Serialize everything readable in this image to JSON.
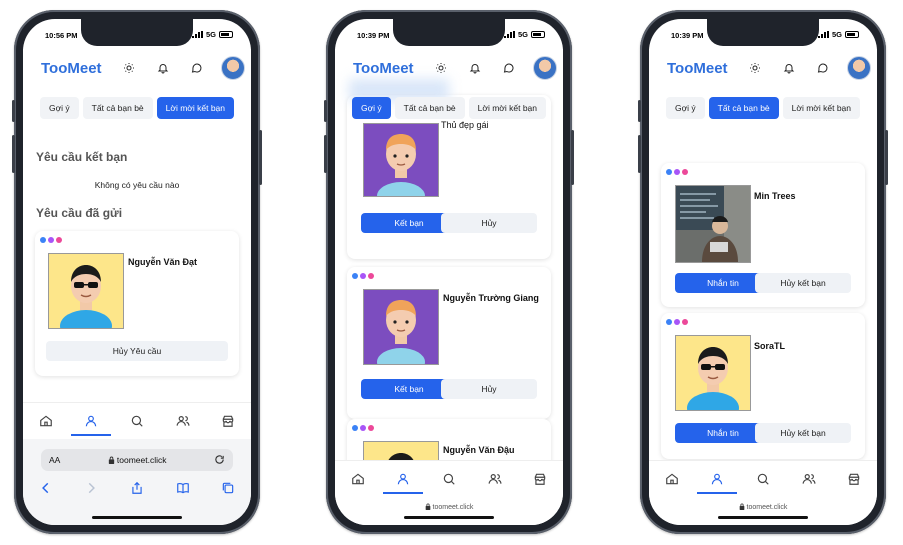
{
  "colors": {
    "accent": "#2563eb",
    "logo": "#2f6fdb",
    "dot1": "#3b82f6",
    "dot2": "#a855f7",
    "dot3": "#ec4899"
  },
  "phones": [
    {
      "time": "10:56 PM",
      "net": "5G",
      "logo": "TooMeet",
      "tabs": [
        "Gợi ý",
        "Tất cả bạn bè",
        "Lời mời kết bạn"
      ],
      "active_tab": 2,
      "requests_title": "Yêu cầu kết bạn",
      "no_requests": "Không có yêu cầu nào",
      "sent_title": "Yêu cầu đã gửi",
      "sent_card": {
        "name": "Nguyễn Văn Đạt",
        "button": "Hủy Yêu cầu",
        "avatar": "avatar-sunglasses"
      },
      "safari": {
        "aa": "AA",
        "url": "toomeet.click"
      }
    },
    {
      "time": "10:39 PM",
      "net": "5G",
      "logo": "TooMeet",
      "tabs": [
        "Gợi ý",
        "Tất cả bạn bè",
        "Lời mời kết bạn"
      ],
      "active_tab": 0,
      "partial_name": "Thủ đẹp gái",
      "cards": [
        {
          "name": "Thủ đẹp gái",
          "primary": "Kết bạn",
          "secondary": "Hủy",
          "avatar": "avatar-orange-hair"
        },
        {
          "name": "Nguyễn Trường Giang",
          "primary": "Kết bạn",
          "secondary": "Hủy",
          "avatar": "avatar-orange-hair"
        },
        {
          "name": "Nguyễn Văn Đậu",
          "avatar": "avatar-sunglasses"
        }
      ],
      "url": "toomeet.click"
    },
    {
      "time": "10:39 PM",
      "net": "5G",
      "logo": "TooMeet",
      "tabs": [
        "Gợi ý",
        "Tất cả bạn bè",
        "Lời mời kết bạn"
      ],
      "active_tab": 1,
      "cards": [
        {
          "name": "Min Trees",
          "primary": "Nhắn tin",
          "secondary": "Hủy kết bạn",
          "avatar": "photo-person-laptop"
        },
        {
          "name": "SoraTL",
          "primary": "Nhắn tin",
          "secondary": "Hủy kết bạn",
          "avatar": "avatar-sunglasses"
        }
      ],
      "url": "toomeet.click"
    }
  ]
}
